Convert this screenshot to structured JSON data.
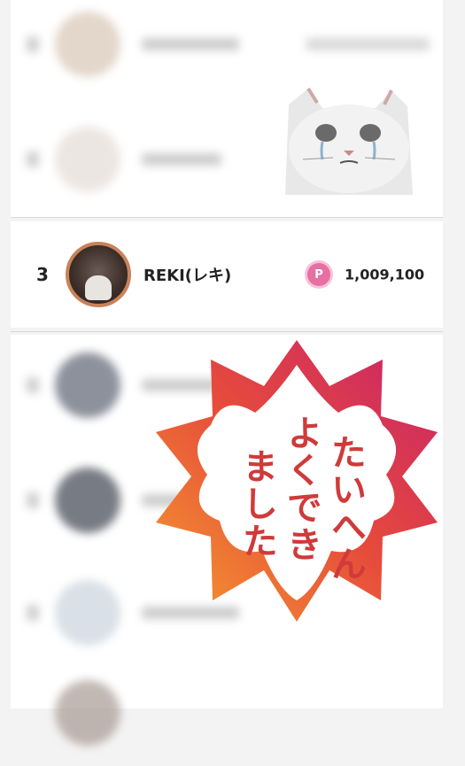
{
  "ranking": {
    "highlighted": {
      "rank": "3",
      "name": "REKI(レキ)",
      "points_icon": "P",
      "points": "1,009,100"
    }
  },
  "sticker": {
    "lines": [
      "たいへん",
      "よくでき",
      "ました"
    ]
  },
  "colors": {
    "stamp_outer": "#e8513a",
    "stamp_inner": "#ffffff",
    "stamp_text": "#d03a3a",
    "points_icon": "#e86fa2"
  },
  "icons": {
    "points": "points-coin-icon",
    "cat": "crying-cat-sticker",
    "stamp": "sakura-stamp"
  }
}
